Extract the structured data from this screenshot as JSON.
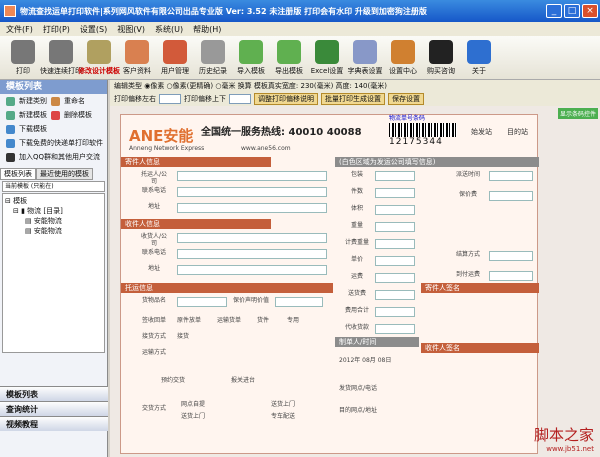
{
  "window": {
    "title": "物流查找运单打印软件|系列网风软件有限公司出品专业版  Ver: 3.52  未注册版  打印会有水印  升级到加密狗注册版"
  },
  "menu": [
    "文件(F)",
    "打印(P)",
    "设置(S)",
    "视图(V)",
    "系统(U)",
    "帮助(H)"
  ],
  "toolbar": [
    {
      "label": "打印",
      "icon": "printer-icon",
      "color": "#777777"
    },
    {
      "label": "快速连续打印",
      "icon": "printer-fast-icon",
      "color": "#777777"
    },
    {
      "label": "修改设计模板",
      "icon": "design-icon",
      "color": "#b0a060",
      "active": true
    },
    {
      "label": "客户资料",
      "icon": "customers-icon",
      "color": "#d98050"
    },
    {
      "label": "用户管理",
      "icon": "users-icon",
      "color": "#d25a3a"
    },
    {
      "label": "历史纪录",
      "icon": "history-icon",
      "color": "#999999"
    },
    {
      "label": "导入模板",
      "icon": "import-icon",
      "color": "#60b050"
    },
    {
      "label": "导出模板",
      "icon": "export-icon",
      "color": "#60b050"
    },
    {
      "label": "Excel设置",
      "icon": "excel-icon",
      "color": "#3a8a3a"
    },
    {
      "label": "字典表设置",
      "icon": "dictionary-icon",
      "color": "#8898c8"
    },
    {
      "label": "设置中心",
      "icon": "settings-icon",
      "color": "#d08030"
    },
    {
      "label": "购买咨询",
      "icon": "qq-icon",
      "color": "#222222"
    },
    {
      "label": "关于",
      "icon": "info-icon",
      "color": "#2e6fd0"
    }
  ],
  "left": {
    "header": "模板列表",
    "actions": [
      "新建类别",
      "重命名",
      "新建模板",
      "删除模板",
      "下载模板",
      "下载免费的快递单打印软件",
      "加入QQ群和其他用户交流"
    ],
    "tabs": [
      "模板列表",
      "最近使用的模板"
    ],
    "search": "当前模板 (只能在)",
    "tree": [
      "模板",
      "物流 [目录]",
      "安能物流",
      "安能物流"
    ],
    "nav": [
      "模板列表",
      "查询统计",
      "视频教程"
    ]
  },
  "controls": {
    "row1": "编辑类型  ◉像素  ○像素(更精确)  ○毫米  换算  模板真实宽度: 230(毫米)  高度: 140(毫米)",
    "row2_a": "打印偏移左右",
    "row2_b": "打印偏移上下",
    "btn1": "调整打印偏移说明",
    "btn2": "批量打印生成设置",
    "btn3": "保存设置"
  },
  "waybill": {
    "logo": "ANE安能",
    "logo_sub": "Anneng Network Express",
    "hotline": "全国统一服务热线: 40010 40088",
    "site": "www.ane56.com",
    "barcode_label": "物流单号条码",
    "barcode_num": "12175344",
    "green": "显示条码控件",
    "sec_send": "寄件人信息",
    "sec_recv": "收件人信息",
    "sec_goods": "托运信息",
    "sec_fee": "(白色区域为发运公司填写信息)",
    "sec_sender_sign": "寄件人签名",
    "sec_receiver_sign": "收件人签名",
    "sender_rows": [
      "托运人/公司",
      "联系电话",
      "地址"
    ],
    "receiver_rows": [
      "收货人/公司",
      "联系电话",
      "地址"
    ],
    "fee_rows": [
      "包装",
      "件数",
      "体积",
      "重量",
      "计费重量",
      "单价",
      "运费",
      "送货费",
      "费用合计",
      "代收货款"
    ],
    "right_rows": [
      "派送时间",
      "保价费",
      "结算方式",
      "到付运费"
    ],
    "goods_rows": [
      "货物品名",
      "保价声明价值",
      "签收回单",
      "接货方式",
      "运输方式",
      "交货方式"
    ],
    "ticks": [
      "原件放单",
      "运输货单",
      "货件",
      "专用",
      "接货",
      "预约交货",
      "报关进台",
      "网点自提",
      "送货上门",
      "送货上门",
      "专车配送"
    ],
    "date": "2012年 08月 08日",
    "shipper_sign": "制单人/时间",
    "phone": "发货网点/电话",
    "dest": "目的网点/地址",
    "right_tab": "始发站",
    "right_tab2": "目的站"
  },
  "watermark": {
    "line1": "脚本之家",
    "line2": "www.jb51.net"
  }
}
